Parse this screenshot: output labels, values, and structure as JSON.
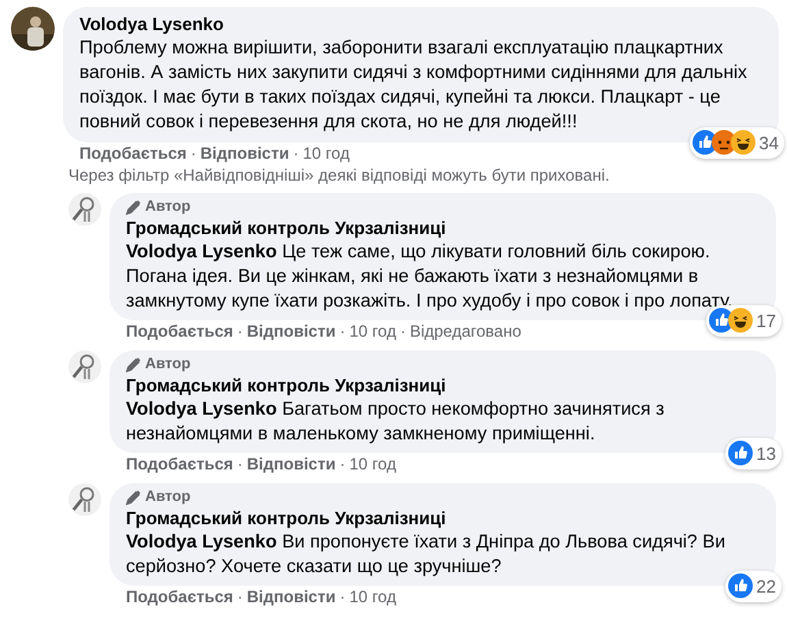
{
  "comment": {
    "author": "Volodya Lysenko",
    "text": "Проблему можна вирішити, заборонити взагалі експлуатацію плацкартних вагонів. А замість них закупити сидячі з комфортними сидіннями для дальніх поїздок. І має бути в таких поїздах сидячі, купейні та люкси. Плацкарт - це повний совок і перевезення для скота, но не для людей!!!",
    "reactions": [
      {
        "kind": "like"
      },
      {
        "kind": "angry"
      },
      {
        "kind": "haha"
      }
    ],
    "reaction_count": "34",
    "actions": [
      {
        "label": "Подобається",
        "kind": "action"
      },
      {
        "label": "Відповісти",
        "kind": "action"
      },
      {
        "label": "10 год",
        "kind": "meta"
      }
    ]
  },
  "separator": "·",
  "filter_note": "Через фільтр «Найвідповідніші» деякі відповіді можуть бути приховані.",
  "replies": [
    {
      "badge": "Автор",
      "author": "Громадський контроль Укрзалізниці",
      "text": "**Volodya Lysenko** Це теж саме, що лікувати головний біль сокирою. Погана ідея. Ви це жінкам, які не бажають їхати з незнайомцями в замкнутому купе їхати розкажіть. І про худобу і про совок і про лопату.",
      "reactions": [
        {
          "kind": "like"
        },
        {
          "kind": "haha"
        }
      ],
      "reaction_count": "17",
      "actions": [
        {
          "label": "Подобається",
          "kind": "action"
        },
        {
          "label": "Відповісти",
          "kind": "action"
        },
        {
          "label": "10 год",
          "kind": "meta"
        },
        {
          "label": "Відредаговано",
          "kind": "meta"
        }
      ]
    },
    {
      "badge": "Автор",
      "author": "Громадський контроль Укрзалізниці",
      "text": "**Volodya Lysenko** Багатьом просто некомфортно зачинятися з незнайомцями в маленькому замкненому приміщенні.",
      "reactions": [
        {
          "kind": "like"
        }
      ],
      "reaction_count": "13",
      "actions": [
        {
          "label": "Подобається",
          "kind": "action"
        },
        {
          "label": "Відповісти",
          "kind": "action"
        },
        {
          "label": "10 год",
          "kind": "meta"
        }
      ]
    },
    {
      "badge": "Автор",
      "author": "Громадський контроль Укрзалізниці",
      "text": "**Volodya Lysenko** Ви пропонуєте їхати з Дніпра до Львова сидячі? Ви серйозно? Хочете сказати що це зручніше?",
      "reactions": [
        {
          "kind": "like"
        }
      ],
      "reaction_count": "22",
      "actions": [
        {
          "label": "Подобається",
          "kind": "action"
        },
        {
          "label": "Відповісти",
          "kind": "action"
        },
        {
          "label": "10 год",
          "kind": "meta"
        }
      ]
    }
  ]
}
